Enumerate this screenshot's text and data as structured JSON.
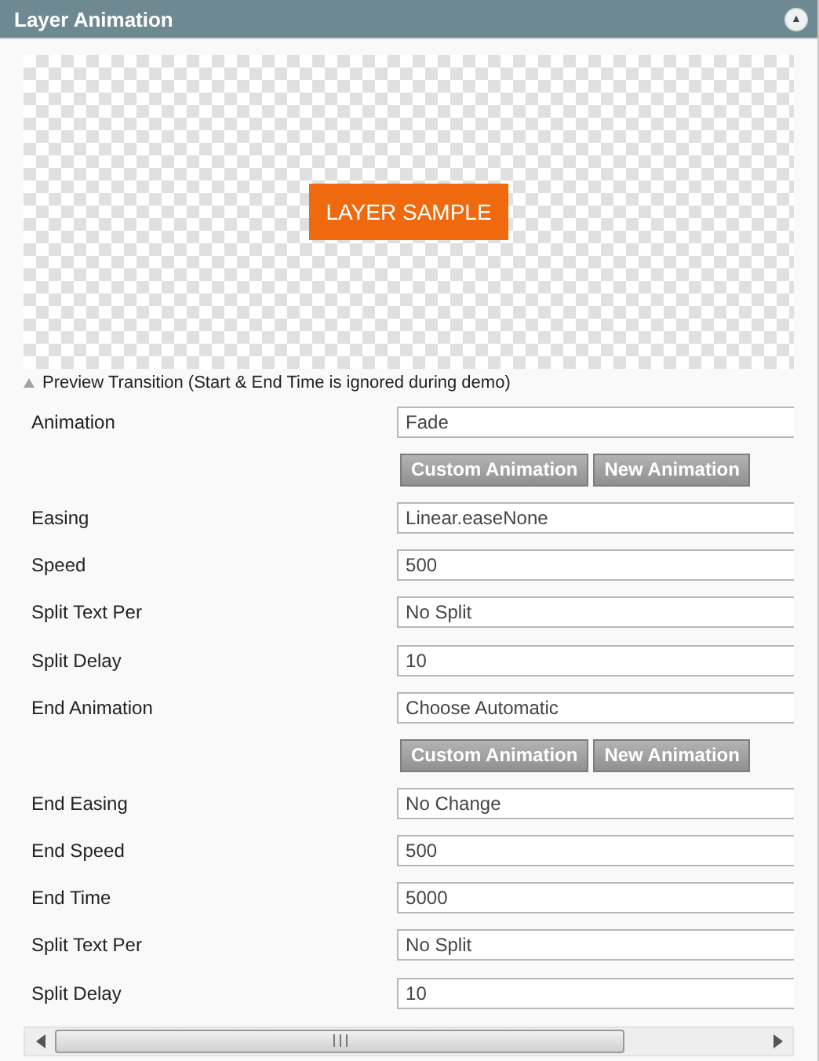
{
  "panel": {
    "title": "Layer Animation",
    "collapse_icon": "▲"
  },
  "preview": {
    "sample": "LAYER SAMPLE",
    "toggle": "Preview Transition (Start & End Time is ignored during demo)",
    "expanded": true
  },
  "rows": [
    {
      "kind": "field",
      "label": "Animation",
      "value": "Fade"
    },
    {
      "kind": "buttons",
      "buttons": [
        "Custom Animation",
        "New Animation"
      ]
    },
    {
      "kind": "field",
      "label": "Easing",
      "value": "Linear.easeNone"
    },
    {
      "kind": "field",
      "label": "Speed",
      "value": "500"
    },
    {
      "kind": "field",
      "label": "Split Text Per",
      "value": "No Split"
    },
    {
      "kind": "field",
      "label": "Split Delay",
      "value": "10"
    },
    {
      "kind": "field",
      "label": "End Animation",
      "value": "Choose Automatic"
    },
    {
      "kind": "buttons",
      "buttons": [
        "Custom Animation",
        "New Animation"
      ]
    },
    {
      "kind": "field",
      "label": "End Easing",
      "value": "No Change"
    },
    {
      "kind": "field",
      "label": "End Speed",
      "value": "500"
    },
    {
      "kind": "field",
      "label": "End Time",
      "value": "5000"
    },
    {
      "kind": "field",
      "label": "Split Text Per",
      "value": "No Split"
    },
    {
      "kind": "field",
      "label": "Split Delay",
      "value": "10"
    }
  ]
}
